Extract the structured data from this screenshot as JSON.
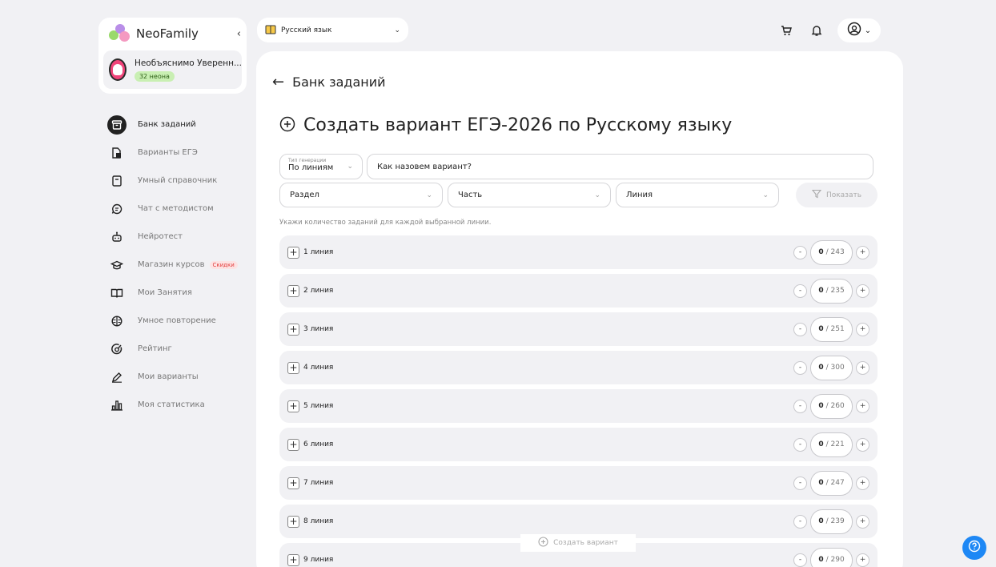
{
  "brand": {
    "name": "NeoFamily",
    "collapse_icon": "chevron-left-icon"
  },
  "profile": {
    "name": "Необъяснимо Уверенн...",
    "badge": "32 неона"
  },
  "sidebar": {
    "items": [
      {
        "label": "Банк заданий",
        "icon": "archive-box-icon",
        "active": true
      },
      {
        "label": "Варианты ЕГЭ",
        "icon": "documents-icon"
      },
      {
        "label": "Умный справочник",
        "icon": "book-icon"
      },
      {
        "label": "Чат с методистом",
        "icon": "chat-icon"
      },
      {
        "label": "Нейротест",
        "icon": "robot-icon"
      },
      {
        "label": "Магазин курсов",
        "icon": "graduation-cap-icon",
        "badge": "Скидки"
      },
      {
        "label": "Мои Занятия",
        "icon": "open-book-icon"
      },
      {
        "label": "Умное повторение",
        "icon": "brain-icon"
      },
      {
        "label": "Рейтинг",
        "icon": "target-icon"
      },
      {
        "label": "Мои варианты",
        "icon": "pencil-icon"
      },
      {
        "label": "Моя статистика",
        "icon": "bar-chart-icon"
      }
    ]
  },
  "topbar": {
    "subject": "Русский язык",
    "icons": [
      "cart-icon",
      "bell-icon",
      "user-circle-icon"
    ]
  },
  "main": {
    "back_label": "Банк заданий",
    "title": "Создать вариант ЕГЭ-2026 по Русскому языку",
    "generation": {
      "caption": "Тип генерации",
      "value": "По линиям"
    },
    "name_placeholder": "Как назовем вариант?",
    "filters": [
      "Раздел",
      "Часть",
      "Линия"
    ],
    "show_button": "Показать",
    "hint": "Укажи количество заданий для каждой выбранной линии.",
    "lines": [
      {
        "label": "1 линия",
        "count": "0",
        "total": "/ 243"
      },
      {
        "label": "2 линия",
        "count": "0",
        "total": "/ 235"
      },
      {
        "label": "3 линия",
        "count": "0",
        "total": "/ 251"
      },
      {
        "label": "4 линия",
        "count": "0",
        "total": "/ 300"
      },
      {
        "label": "5 линия",
        "count": "0",
        "total": "/ 260"
      },
      {
        "label": "6 линия",
        "count": "0",
        "total": "/ 221"
      },
      {
        "label": "7 линия",
        "count": "0",
        "total": "/ 247"
      },
      {
        "label": "8 линия",
        "count": "0",
        "total": "/ 239"
      },
      {
        "label": "9 линия",
        "count": "0",
        "total": "/ 290"
      }
    ],
    "create_button": "Создать вариант"
  },
  "colors": {
    "accent": "#1e88f5",
    "background": "#f1f1f4",
    "sale": "#e23b3b",
    "neon_badge": "#c9efb3"
  }
}
